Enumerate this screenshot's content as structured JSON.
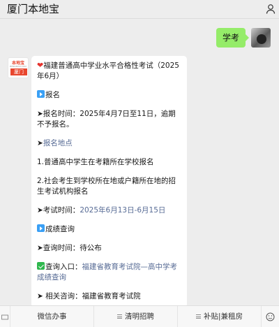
{
  "header": {
    "title": "厦门本地宝",
    "user_icon": "user-icon"
  },
  "chat": {
    "sent_message": "学考",
    "bot_logo_top": "本地宝",
    "bot_logo_mid": "BENDIBAO.COM",
    "bot_logo_bar": "厦门"
  },
  "article": {
    "title": "福建普通高中学业水平合格性考试（2025年6月）",
    "registration_heading": "报名",
    "registration_time": "➤报名时间：2025年4月7日至11日，逾期不予报名。",
    "registration_place_prefix": "➤",
    "registration_place_link": "报名地点",
    "place_1": "1.普通高中学生在考籍所在学校报名",
    "place_2": "2.社会考生到学校所在地或户籍所在地的招生考试机构报名",
    "exam_time_prefix": "➤考试时间：",
    "exam_time_value": "2025年6月13日-6月15日",
    "score_heading": "成绩查询",
    "query_time": "➤查询时间：待公布",
    "query_entry_prefix": "查询入口：",
    "query_entry_link": "福建省教育考试院—高中学考成绩查询",
    "cut_line": "➤ 相关咨询：福建省教育考试院"
  },
  "bottom_menu": {
    "tabs": [
      "微信办事",
      "清明招聘",
      "补贴|兼租房"
    ]
  },
  "colors": {
    "green_bubble": "#95ec69",
    "link_blue": "#576b95",
    "brand_red": "#e8462e"
  }
}
